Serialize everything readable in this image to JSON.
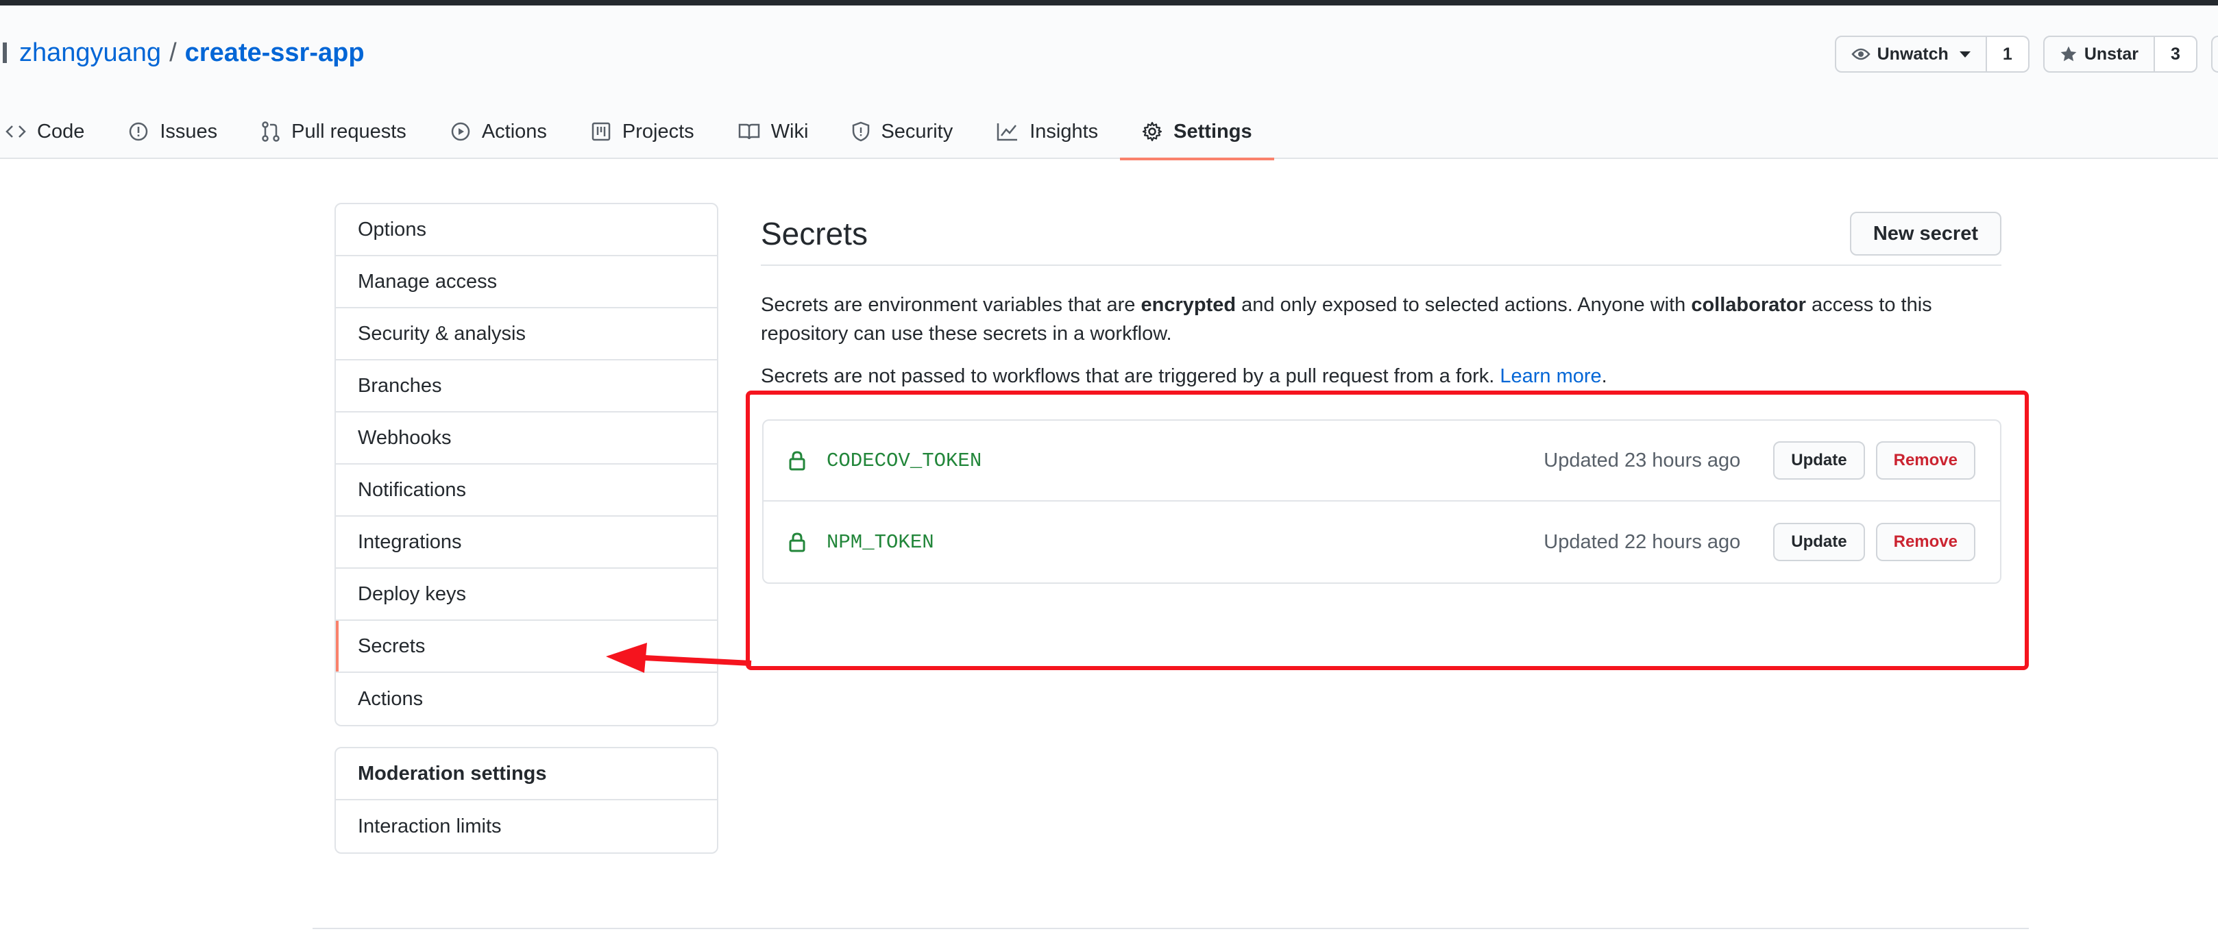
{
  "repo": {
    "owner": "zhangyuang",
    "separator": "/",
    "name": "create-ssr-app"
  },
  "actions": {
    "watch_label": "Unwatch",
    "watch_count": "1",
    "star_label": "Unstar",
    "star_count": "3"
  },
  "nav": {
    "tabs": [
      {
        "label": "Code",
        "icon": "code-icon"
      },
      {
        "label": "Issues",
        "icon": "issue-opened-icon"
      },
      {
        "label": "Pull requests",
        "icon": "git-pull-request-icon"
      },
      {
        "label": "Actions",
        "icon": "play-icon"
      },
      {
        "label": "Projects",
        "icon": "project-icon"
      },
      {
        "label": "Wiki",
        "icon": "book-icon"
      },
      {
        "label": "Security",
        "icon": "shield-icon"
      },
      {
        "label": "Insights",
        "icon": "graph-icon"
      },
      {
        "label": "Settings",
        "icon": "gear-icon",
        "selected": true
      }
    ]
  },
  "sidebar": {
    "items": [
      {
        "label": "Options"
      },
      {
        "label": "Manage access"
      },
      {
        "label": "Security & analysis"
      },
      {
        "label": "Branches"
      },
      {
        "label": "Webhooks"
      },
      {
        "label": "Notifications"
      },
      {
        "label": "Integrations"
      },
      {
        "label": "Deploy keys"
      },
      {
        "label": "Secrets",
        "selected": true
      },
      {
        "label": "Actions"
      }
    ],
    "moderation": {
      "heading": "Moderation settings",
      "items": [
        {
          "label": "Interaction limits"
        }
      ]
    }
  },
  "main": {
    "title": "Secrets",
    "new_button": "New secret",
    "desc_part1": "Secrets are environment variables that are ",
    "desc_bold1": "encrypted",
    "desc_part2": " and only exposed to selected actions. Anyone with ",
    "desc_bold2": "collaborator",
    "desc_part3": " access to this repository can use these secrets in a workflow.",
    "desc2_text": "Secrets are not passed to workflows that are triggered by a pull request from a fork. ",
    "desc2_link": "Learn more",
    "desc2_end": ".",
    "secrets": [
      {
        "name": "CODECOV_TOKEN",
        "updated": "Updated 23 hours ago",
        "update_label": "Update",
        "remove_label": "Remove"
      },
      {
        "name": "NPM_TOKEN",
        "updated": "Updated 22 hours ago",
        "update_label": "Update",
        "remove_label": "Remove"
      }
    ]
  },
  "colors": {
    "link": "#0366d6",
    "accent_tab": "#f9826c",
    "secret_name": "#22863a",
    "danger": "#cb2431",
    "annotation": "#f5141e"
  }
}
